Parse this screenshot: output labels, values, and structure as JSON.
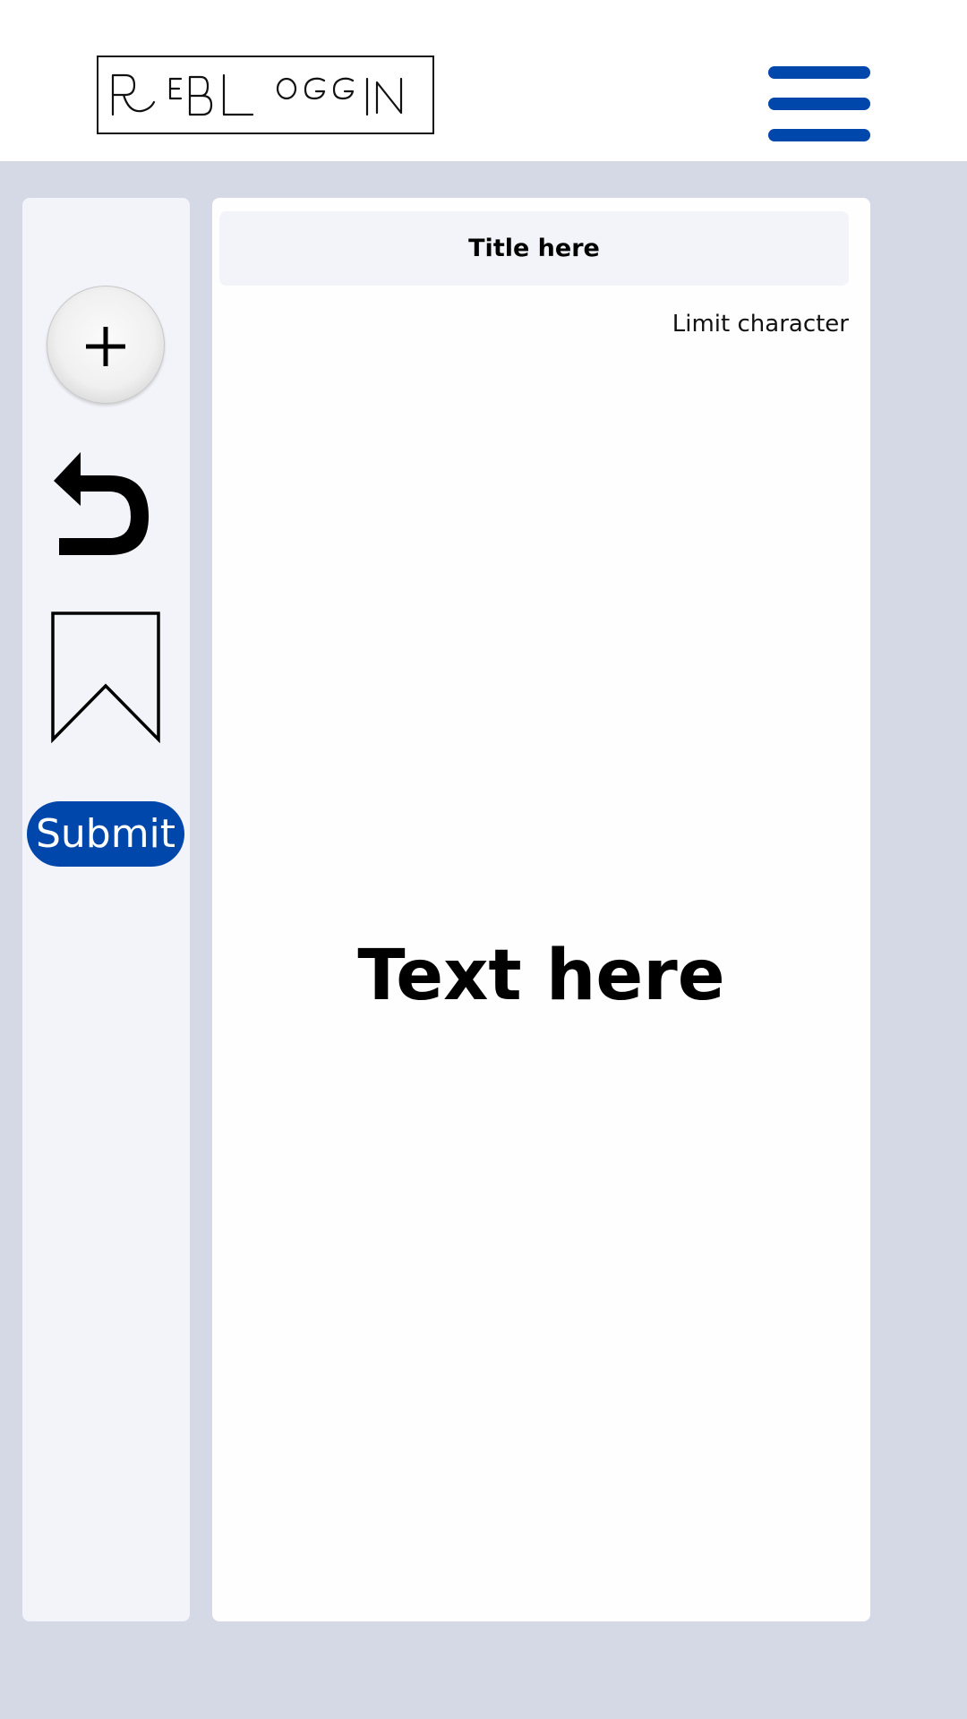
{
  "header": {
    "logo_text": "R EBL OGGIN",
    "menu_icon": "hamburger-menu-icon"
  },
  "sidebar": {
    "add_icon": "plus-icon",
    "undo_icon": "undo-arrow-icon",
    "bookmark_icon": "bookmark-icon",
    "submit_label": "Submit"
  },
  "editor": {
    "title_placeholder": "Title here",
    "limit_label": "Limit character",
    "text_placeholder": "Text here"
  },
  "colors": {
    "accent": "#0047ab",
    "background": "#d5d9e5",
    "header_bg": "#ffffff",
    "sidebar_bg": "#f3f4fa",
    "editor_bg": "#fefefe",
    "title_field_bg": "#f3f4f9"
  }
}
